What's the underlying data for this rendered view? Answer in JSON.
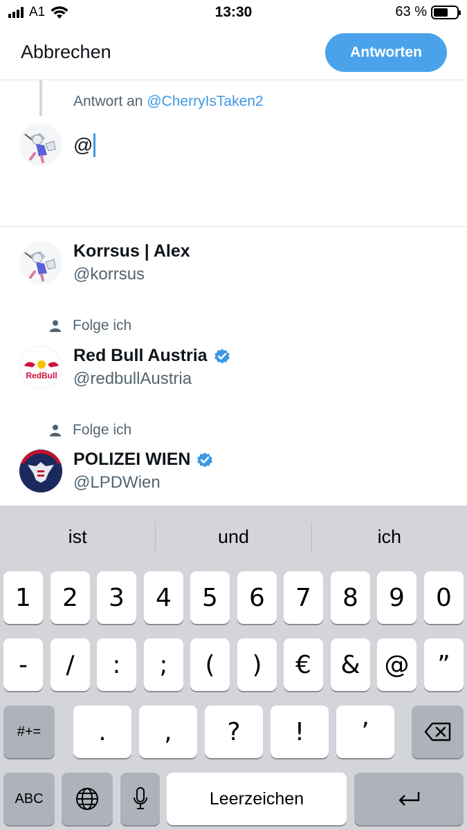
{
  "status_bar": {
    "carrier": "A1",
    "time": "13:30",
    "battery": "63 %"
  },
  "header": {
    "cancel_label": "Abbrechen",
    "reply_label": "Antworten"
  },
  "compose": {
    "reply_prefix": "Antwort an",
    "reply_handle": "@CherryIsTaken2",
    "text": "@"
  },
  "suggestions": [
    {
      "name": "Korrsus | Alex",
      "handle": "@korrsus",
      "follow_label": "",
      "verified": false
    },
    {
      "name": "Red Bull Austria",
      "handle": "@redbullAustria",
      "follow_label": "Folge ich",
      "verified": true
    },
    {
      "name": "POLIZEI WIEN",
      "handle": "@LPDWien",
      "follow_label": "Folge ich",
      "verified": true
    }
  ],
  "keyboard": {
    "predictions": [
      "ist",
      "und",
      "ich"
    ],
    "row1": [
      "1",
      "2",
      "3",
      "4",
      "5",
      "6",
      "7",
      "8",
      "9",
      "0"
    ],
    "row2": [
      "-",
      "/",
      ":",
      ";",
      "(",
      ")",
      "€",
      "&",
      "@",
      "”"
    ],
    "row3_mode": "#+=",
    "row3": [
      ".",
      ",",
      "?",
      "!",
      "’"
    ],
    "abc": "ABC",
    "space": "Leerzeichen"
  },
  "colors": {
    "accent": "#4aa3ea",
    "link": "#3b98e3",
    "muted": "#536471",
    "keyboard_bg": "#d3d5db"
  }
}
